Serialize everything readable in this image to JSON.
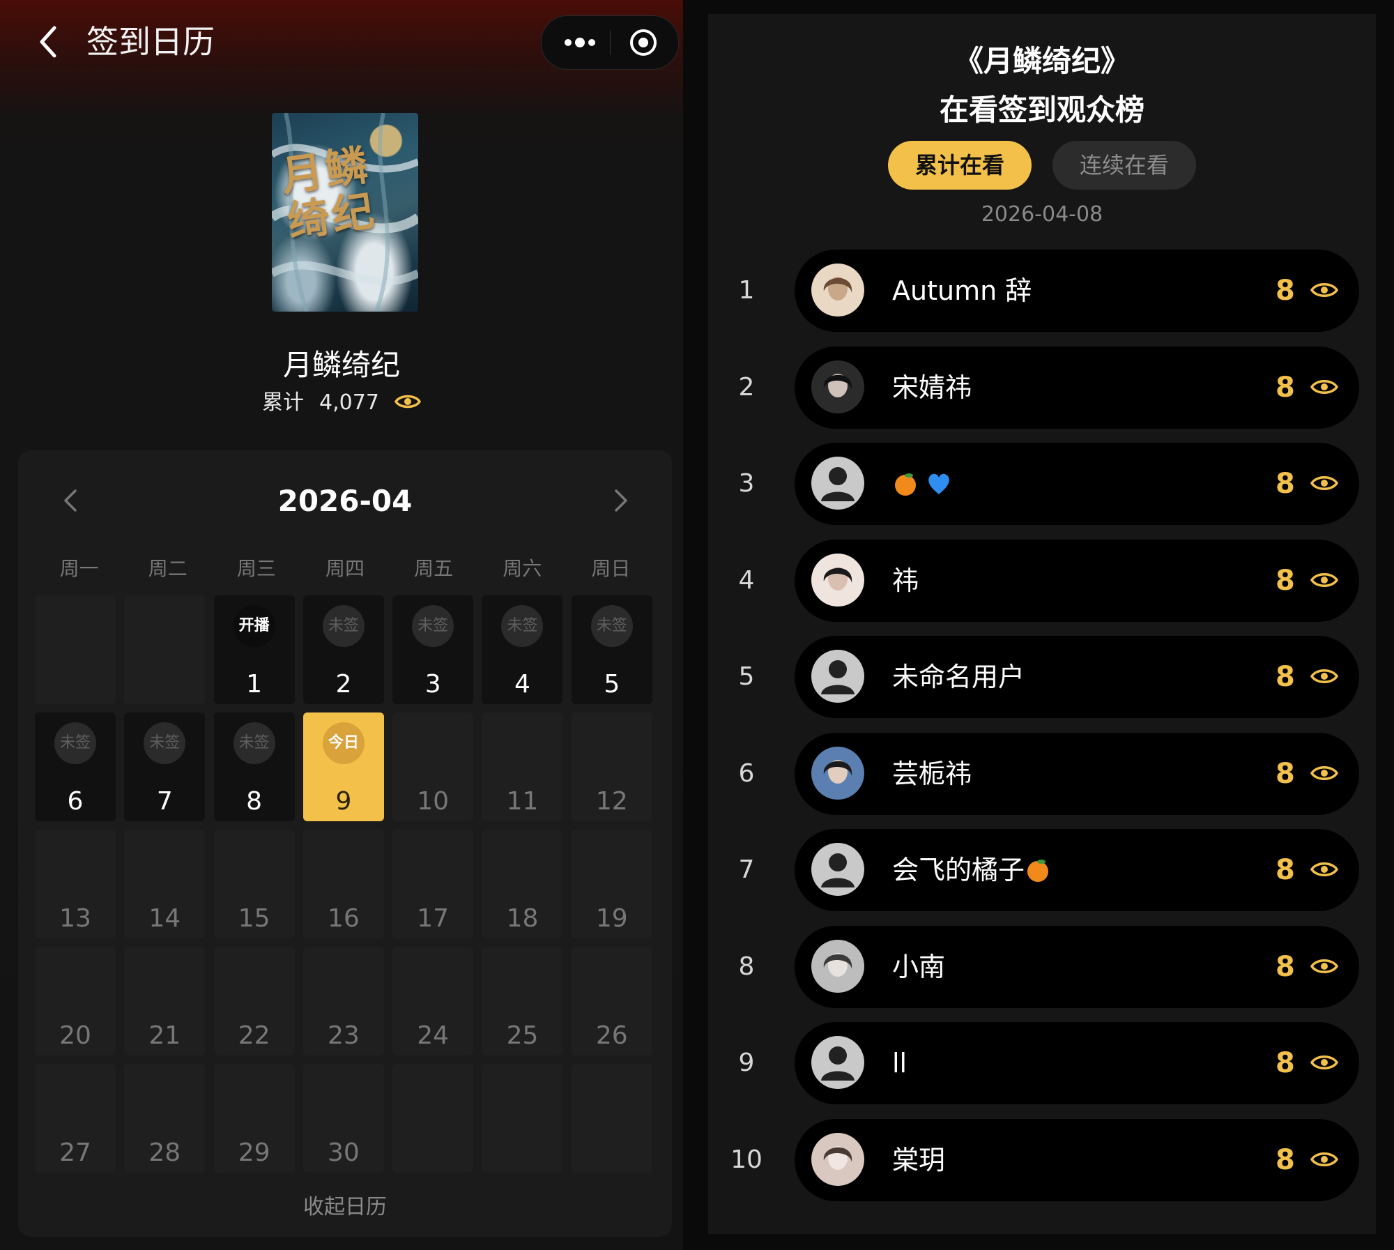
{
  "header": {
    "title": "签到日历"
  },
  "show": {
    "name": "月鳞绮纪",
    "poster_title": "月鳞绮纪",
    "cumulative_label": "累计",
    "cumulative_count": "4,077"
  },
  "calendar": {
    "month": "2026-04",
    "weekdays": [
      "周一",
      "周二",
      "周三",
      "周四",
      "周五",
      "周六",
      "周日"
    ],
    "collapse_label": "收起日历",
    "cells": [
      {
        "day": "",
        "badge": "",
        "state": "empty"
      },
      {
        "day": "",
        "badge": "",
        "state": "empty"
      },
      {
        "day": "1",
        "badge": "开播",
        "state": "start"
      },
      {
        "day": "2",
        "badge": "未签",
        "state": "missed"
      },
      {
        "day": "3",
        "badge": "未签",
        "state": "missed"
      },
      {
        "day": "4",
        "badge": "未签",
        "state": "missed"
      },
      {
        "day": "5",
        "badge": "未签",
        "state": "missed"
      },
      {
        "day": "6",
        "badge": "未签",
        "state": "missed"
      },
      {
        "day": "7",
        "badge": "未签",
        "state": "missed"
      },
      {
        "day": "8",
        "badge": "未签",
        "state": "missed"
      },
      {
        "day": "9",
        "badge": "今日",
        "state": "today"
      },
      {
        "day": "10",
        "badge": "",
        "state": "future"
      },
      {
        "day": "11",
        "badge": "",
        "state": "future"
      },
      {
        "day": "12",
        "badge": "",
        "state": "future"
      },
      {
        "day": "13",
        "badge": "",
        "state": "future"
      },
      {
        "day": "14",
        "badge": "",
        "state": "future"
      },
      {
        "day": "15",
        "badge": "",
        "state": "future"
      },
      {
        "day": "16",
        "badge": "",
        "state": "future"
      },
      {
        "day": "17",
        "badge": "",
        "state": "future"
      },
      {
        "day": "18",
        "badge": "",
        "state": "future"
      },
      {
        "day": "19",
        "badge": "",
        "state": "future"
      },
      {
        "day": "20",
        "badge": "",
        "state": "future"
      },
      {
        "day": "21",
        "badge": "",
        "state": "future"
      },
      {
        "day": "22",
        "badge": "",
        "state": "future"
      },
      {
        "day": "23",
        "badge": "",
        "state": "future"
      },
      {
        "day": "24",
        "badge": "",
        "state": "future"
      },
      {
        "day": "25",
        "badge": "",
        "state": "future"
      },
      {
        "day": "26",
        "badge": "",
        "state": "future"
      },
      {
        "day": "27",
        "badge": "",
        "state": "future"
      },
      {
        "day": "28",
        "badge": "",
        "state": "future"
      },
      {
        "day": "29",
        "badge": "",
        "state": "future"
      },
      {
        "day": "30",
        "badge": "",
        "state": "future"
      },
      {
        "day": "",
        "badge": "",
        "state": "empty"
      },
      {
        "day": "",
        "badge": "",
        "state": "empty"
      },
      {
        "day": "",
        "badge": "",
        "state": "empty"
      }
    ]
  },
  "leaderboard": {
    "title_line1": "《月鳞绮纪》",
    "title_line2": "在看签到观众榜",
    "tab_active": "累计在看",
    "tab_inactive": "连续在看",
    "date": "2026-04-08",
    "entries": [
      {
        "rank": "1",
        "name": "Autumn 辞",
        "score": "8",
        "avatar": "photo",
        "emoji": []
      },
      {
        "rank": "2",
        "name": "宋婧祎",
        "score": "8",
        "avatar": "photo",
        "emoji": []
      },
      {
        "rank": "3",
        "name": "",
        "score": "8",
        "avatar": "default",
        "emoji": [
          "orange-emoji",
          "blue-heart-emoji"
        ]
      },
      {
        "rank": "4",
        "name": "祎",
        "score": "8",
        "avatar": "photo",
        "emoji": []
      },
      {
        "rank": "5",
        "name": "未命名用户",
        "score": "8",
        "avatar": "default",
        "emoji": []
      },
      {
        "rank": "6",
        "name": "芸栀祎",
        "score": "8",
        "avatar": "photo",
        "emoji": []
      },
      {
        "rank": "7",
        "name": "会飞的橘子",
        "score": "8",
        "avatar": "default",
        "emoji": [
          "orange-emoji"
        ]
      },
      {
        "rank": "8",
        "name": "小南",
        "score": "8",
        "avatar": "photo",
        "emoji": []
      },
      {
        "rank": "9",
        "name": "ll",
        "score": "8",
        "avatar": "default",
        "emoji": []
      },
      {
        "rank": "10",
        "name": "棠玥",
        "score": "8",
        "avatar": "photo",
        "emoji": []
      }
    ]
  },
  "colors": {
    "accent": "#f3c14a",
    "background": "#0a0a0a",
    "panel": "#161616"
  }
}
